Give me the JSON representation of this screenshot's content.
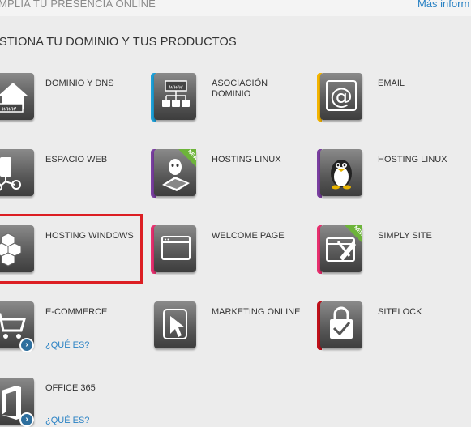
{
  "topbar": {
    "left_text": "MPLIA TU PRESENCIA ONLINE",
    "right_link": "Más inform"
  },
  "section_title": "STIONA TU DOMINIO Y TUS PRODUCTOS",
  "products": [
    {
      "id": "dominio-dns",
      "label": "DOMINIO Y DNS",
      "icon": "house-www-icon",
      "stripe": null,
      "new": false
    },
    {
      "id": "asociacion-dominio",
      "label": "ASOCIACIÓN DOMINIO",
      "icon": "network-www-icon",
      "stripe": "#1da0d8",
      "new": false
    },
    {
      "id": "email",
      "label": "EMAIL",
      "icon": "at-sign-icon",
      "stripe": "#f4b400",
      "new": false
    },
    {
      "id": "espacio-web",
      "label": "ESPACIO WEB",
      "icon": "server-connection-icon",
      "stripe": null,
      "new": false
    },
    {
      "id": "hosting-linux-new",
      "label": "HOSTING LINUX",
      "icon": "linux-server-icon",
      "stripe": "#7a3fa0",
      "new": true
    },
    {
      "id": "hosting-linux",
      "label": "HOSTING LINUX",
      "icon": "penguin-icon",
      "stripe": "#7a3fa0",
      "new": false
    },
    {
      "id": "hosting-windows",
      "label": "HOSTING WINDOWS",
      "icon": "cubes-icon",
      "stripe": null,
      "new": false
    },
    {
      "id": "welcome-page",
      "label": "WELCOME PAGE",
      "icon": "browser-window-icon",
      "stripe": "#e8306f",
      "new": false
    },
    {
      "id": "simply-site",
      "label": "SIMPLY SITE",
      "icon": "tools-browser-icon",
      "stripe": "#e8306f",
      "new": true
    },
    {
      "id": "e-commerce",
      "label": "E-COMMERCE",
      "icon": "shopping-cart-icon",
      "stripe": null,
      "new": false
    },
    {
      "id": "marketing-online",
      "label": "MARKETING ONLINE",
      "icon": "cursor-window-icon",
      "stripe": null,
      "new": false
    },
    {
      "id": "sitelock",
      "label": "SITELOCK",
      "icon": "lock-check-icon",
      "stripe": "#c0101a",
      "new": false
    },
    {
      "id": "office-365",
      "label": "OFFICE 365",
      "icon": "office-icon",
      "stripe": null,
      "new": false
    }
  ],
  "links": {
    "ecommerce_info": "¿QUÉ ES?",
    "office_info": "¿QUÉ ES?"
  },
  "badges": {
    "new_label": "NEW"
  },
  "info_glyph": "›"
}
